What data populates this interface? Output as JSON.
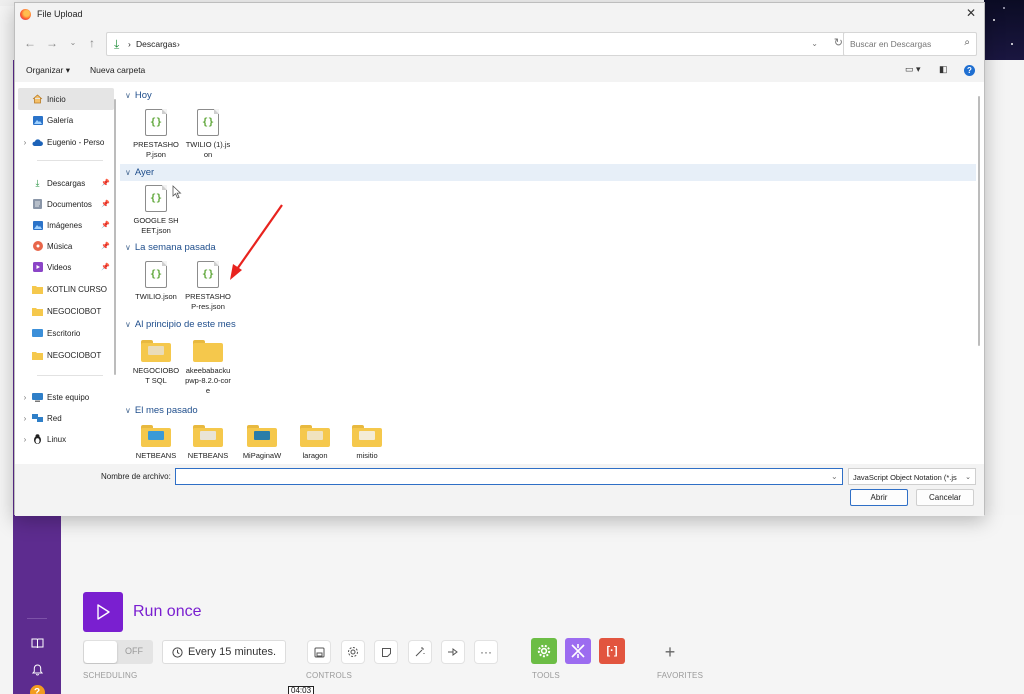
{
  "dialog": {
    "title": "File Upload",
    "address": {
      "path": [
        "Descargas"
      ]
    },
    "search": {
      "placeholder": "Buscar en Descargas"
    },
    "commands": {
      "organize": "Organizar",
      "new_folder": "Nueva carpeta"
    },
    "nav_items": [
      {
        "label": "Inicio",
        "icon": "home-icon",
        "selected": true
      },
      {
        "label": "Galería",
        "icon": "gallery-icon"
      },
      {
        "label": "Eugenio - Perso",
        "icon": "cloud-icon"
      },
      {
        "label": "Descargas",
        "icon": "download-icon",
        "pinned": true
      },
      {
        "label": "Documentos",
        "icon": "document-icon",
        "pinned": true
      },
      {
        "label": "Imágenes",
        "icon": "image-icon",
        "pinned": true
      },
      {
        "label": "Música",
        "icon": "music-icon",
        "pinned": true
      },
      {
        "label": "Videos",
        "icon": "video-icon",
        "pinned": true
      },
      {
        "label": "KOTLIN CURSO",
        "icon": "folder-icon"
      },
      {
        "label": "NEGOCIOBOT",
        "icon": "folder-icon"
      },
      {
        "label": "Escritorio",
        "icon": "desktop-icon"
      },
      {
        "label": "NEGOCIOBOT",
        "icon": "folder-icon"
      },
      {
        "label": "Este equipo",
        "icon": "computer-icon"
      },
      {
        "label": "Red",
        "icon": "network-icon"
      },
      {
        "label": "Linux",
        "icon": "linux-icon"
      }
    ],
    "groups": [
      {
        "label": "Hoy",
        "files": [
          {
            "name": "PRESTASHOP.json",
            "type": "json"
          },
          {
            "name": "TWILIO (1).json",
            "type": "json"
          }
        ]
      },
      {
        "label": "Ayer",
        "files": [
          {
            "name": "GOOGLE SHEET.json",
            "type": "json"
          }
        ]
      },
      {
        "label": "La semana pasada",
        "files": [
          {
            "name": "TWILIO.json",
            "type": "json"
          },
          {
            "name": "PRESTASHOP-res.json",
            "type": "json"
          }
        ]
      },
      {
        "label": "Al principio de este mes",
        "files": [
          {
            "name": "NEGOCIOBOT SQL",
            "type": "folder"
          },
          {
            "name": "akeebabackupwp-8.2.0-core",
            "type": "folder"
          }
        ]
      },
      {
        "label": "El mes pasado",
        "files": [
          {
            "name": "NETBEANS",
            "type": "folder"
          },
          {
            "name": "NETBEANS",
            "type": "folder"
          },
          {
            "name": "MiPaginaW",
            "type": "folder"
          },
          {
            "name": "laragon",
            "type": "folder"
          },
          {
            "name": "misitio",
            "type": "folder"
          }
        ]
      }
    ],
    "filename": {
      "label": "Nombre de archivo:",
      "value": ""
    },
    "filter": "JavaScript Object Notation (*.js",
    "open_button": "Abrir",
    "cancel_button": "Cancelar"
  },
  "app": {
    "run_once": "Run once",
    "toggle_off": "OFF",
    "schedule": "Every 15 minutes.",
    "labels": {
      "scheduling": "SCHEDULING",
      "controls": "CONTROLS",
      "tools": "TOOLS",
      "favorites": "FAVORITES"
    },
    "time": "04:03",
    "colors": {
      "sidebar": "#5d2c8f",
      "accent": "#7a1fd0",
      "tool_green": "#6cbd45",
      "tool_purple": "#9c6cf0",
      "tool_red": "#e2553f"
    }
  }
}
